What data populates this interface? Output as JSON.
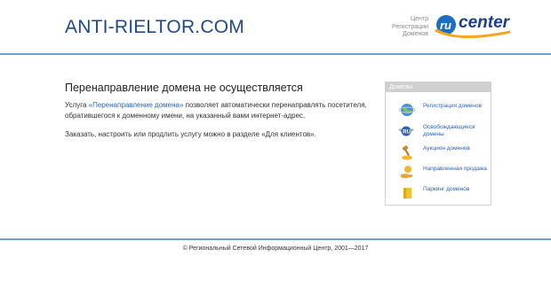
{
  "header": {
    "site_title": "ANTI-RIELTOR.COM",
    "ru_center_caption": [
      "Центр",
      "Регистрации",
      "Доменов"
    ],
    "ru_center_logo_text": "center",
    "brand_color": "#1a3f8a",
    "accent_color": "#f5a623"
  },
  "main": {
    "heading": "Перенаправление домена не осуществляется",
    "para1_prefix": "Услуга ",
    "para1_link": "«Перенаправление домена»",
    "para1_suffix": " позволяет автоматически перенаправлять посетителя, обратившегося к доменному имени, на указанный вами интернет-адрес.",
    "para2": "Заказать, настроить или продлить услугу можно в разделе «Для клиентов»."
  },
  "sidebar": {
    "title": "Домены",
    "items": [
      {
        "label": "Регистрация доменов",
        "icon": "globe-icon"
      },
      {
        "label": "Освобождающиеся домены",
        "icon": "ru-wings-icon"
      },
      {
        "label": "Аукцион доменов",
        "icon": "auction-coin-icon"
      },
      {
        "label": "Направленная продажа",
        "icon": "hand-coin-icon"
      },
      {
        "label": "Паркинг доменов",
        "icon": "parking-box-icon"
      }
    ]
  },
  "footer": {
    "copyright": "© Региональный Сетевой Информационный Центр, 2001—2017"
  }
}
